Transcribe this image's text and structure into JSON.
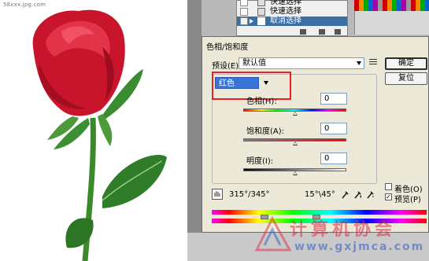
{
  "photo": {
    "watermark_top": "58xxx.jpg.com"
  },
  "history_panel": {
    "items": [
      {
        "label": "快速选择",
        "selected": false
      },
      {
        "label": "快速选择",
        "selected": false
      },
      {
        "label": "取消选择",
        "selected": true
      }
    ]
  },
  "dialog": {
    "title": "色相/饱和度",
    "preset_label": "预设(E):",
    "preset_value": "默认值",
    "menu_icon": "options-list-icon",
    "ok_button": "确定",
    "reset_button": "复位",
    "channel_value": "红色",
    "hue": {
      "label": "色相(H):",
      "value": "0"
    },
    "saturation": {
      "label": "饱和度(A):",
      "value": "0"
    },
    "lightness": {
      "label": "明度(I):",
      "value": "0"
    },
    "range_left": "315°/345°",
    "range_right": "15°\\45°",
    "colorize_label": "着色(O)",
    "colorize_checked": false,
    "preview_label": "预览(P)",
    "preview_checked": true
  },
  "watermark": {
    "text_cn": "计算机协会",
    "url": "www.gxjmca.com"
  },
  "colors": {
    "highlight": "#3874d8",
    "annotation_red": "#e8202a",
    "dialog_bg": "#ece9d8"
  }
}
